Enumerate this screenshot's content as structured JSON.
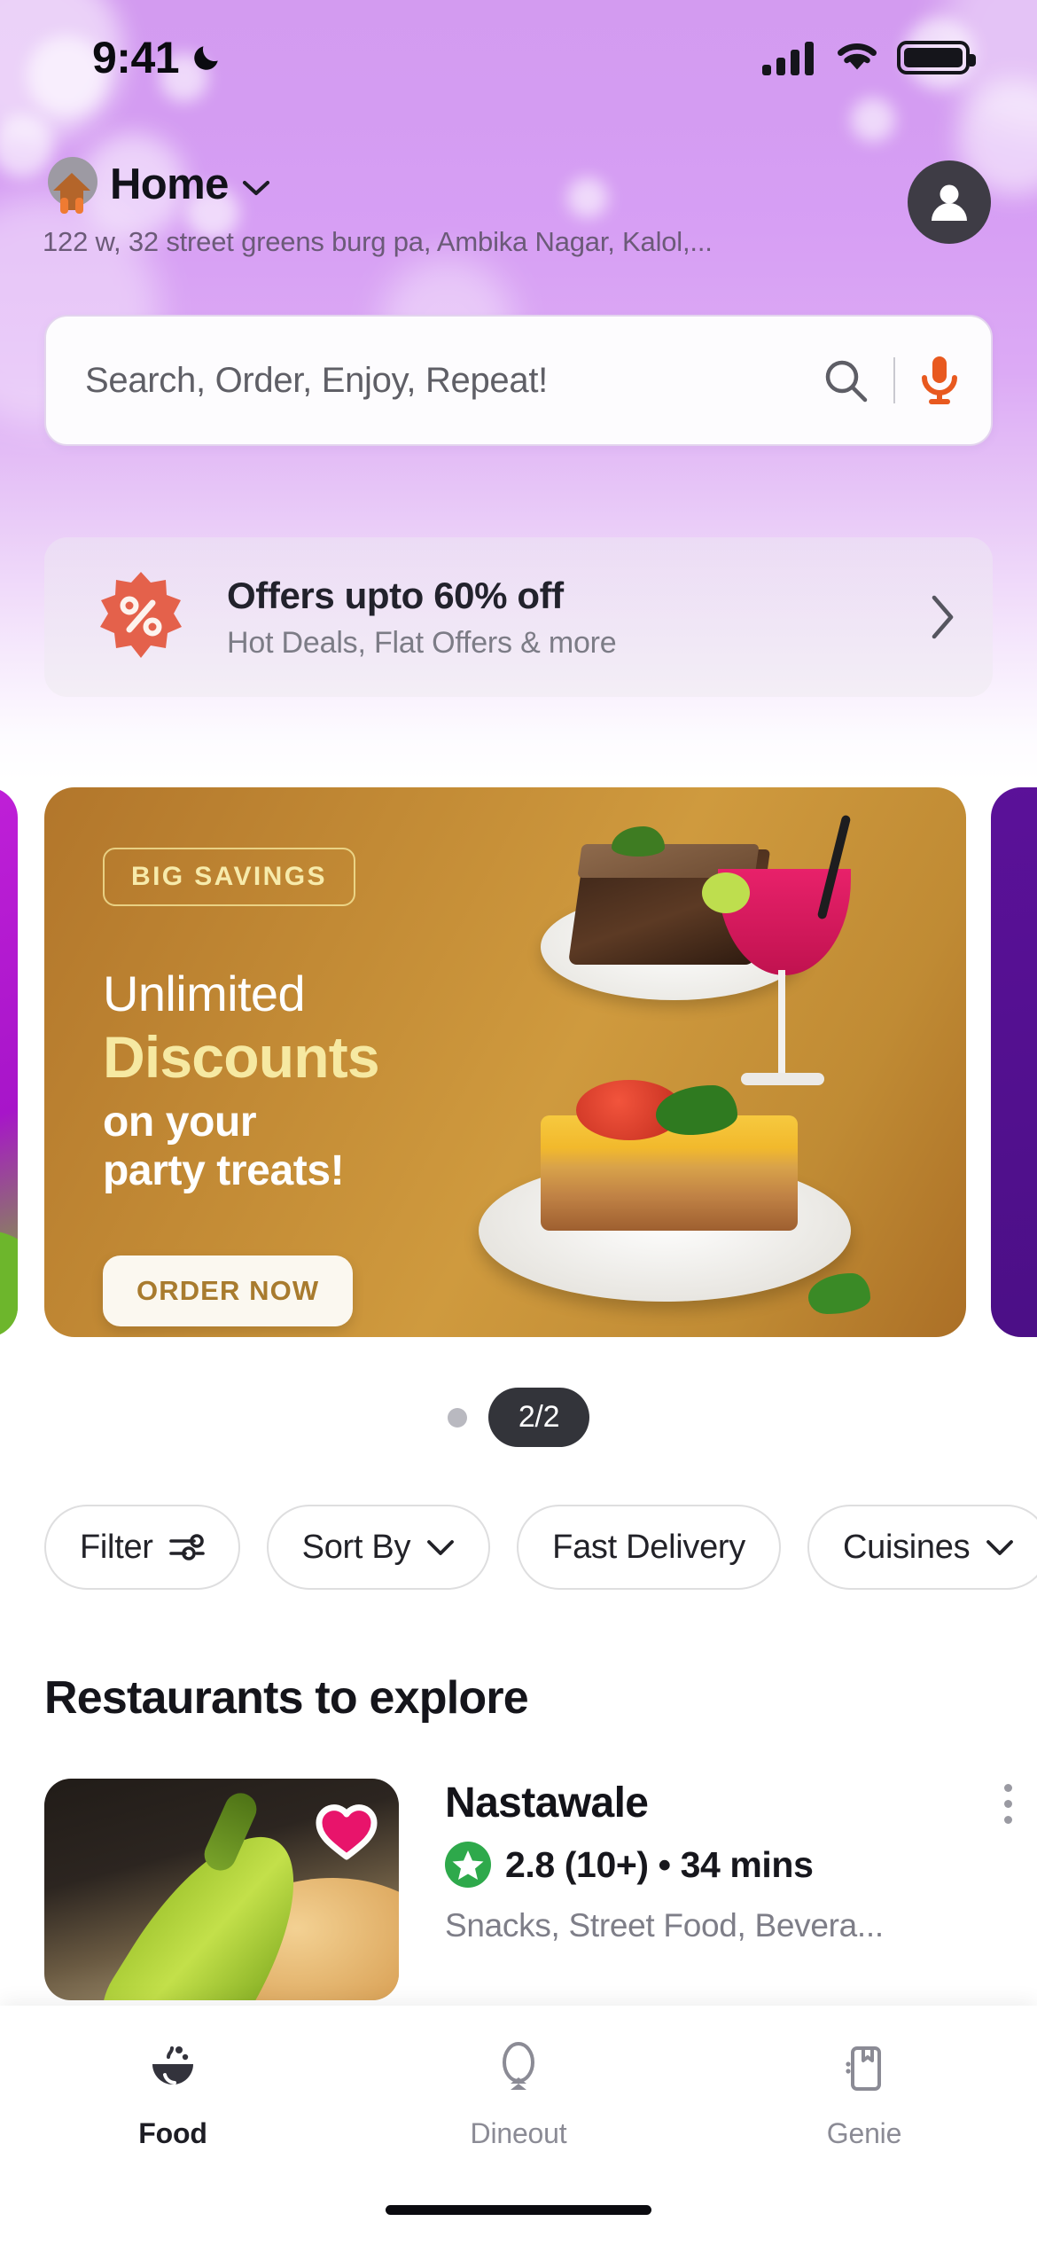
{
  "status_bar": {
    "time": "9:41",
    "moon_icon": "crescent-moon-icon",
    "signal_icon": "cellular-signal-icon",
    "wifi_icon": "wifi-icon",
    "battery_icon": "battery-full-icon"
  },
  "header": {
    "home_icon": "house-icon",
    "location_label": "Home",
    "chevron_icon": "chevron-down-icon",
    "address": "122 w, 32 street greens burg pa, Ambika Nagar, Kalol,...",
    "avatar_icon": "user-avatar-icon"
  },
  "search": {
    "placeholder": "Search, Order, Enjoy, Repeat!",
    "value": "",
    "search_icon": "search-icon",
    "mic_icon": "microphone-icon",
    "mic_color": "#E8591F"
  },
  "offers_banner": {
    "badge_icon": "percent-starburst-icon",
    "badge_color": "#E4614B",
    "title": "Offers upto 60% off",
    "subtitle": "Hot Deals, Flat Offers & more",
    "chevron_icon": "chevron-right-icon"
  },
  "carousel": {
    "current_slide": {
      "tag": "BIG SAVINGS",
      "line1": "Unlimited",
      "line2": "Discounts",
      "line3": "on your\nparty treats!",
      "cta_label": "ORDER NOW",
      "background_color": "#C08B34",
      "accent_color": "#F6E9A2"
    },
    "prev_slide_color": "#B41ECB",
    "next_slide_color": "#4F1090",
    "pager_label": "2/2",
    "pager_dot": "inactive-dot"
  },
  "filters": {
    "chips": [
      {
        "label": "Filter",
        "icon": "sliders-icon"
      },
      {
        "label": "Sort By",
        "icon": "chevron-down-icon"
      },
      {
        "label": "Fast Delivery",
        "icon": "none"
      },
      {
        "label": "Cuisines",
        "icon": "chevron-down-icon"
      }
    ]
  },
  "restaurants_section": {
    "title": "Restaurants to explore",
    "items": [
      {
        "name": "Nastawale",
        "rating": "2.8 (10+) • 34 mins",
        "cuisines": "Snacks, Street Food, Bevera...",
        "favorite_icon": "heart-filled-icon",
        "favorite_color": "#E8146B",
        "rating_badge_icon": "star-badge-icon",
        "rating_badge_color": "#2EA94B",
        "more_icon": "kebab-menu-icon"
      }
    ]
  },
  "bottom_nav": {
    "items": [
      {
        "label": "Food",
        "icon": "food-bowl-icon",
        "active": true
      },
      {
        "label": "Dineout",
        "icon": "plate-cutlery-icon",
        "active": false
      },
      {
        "label": "Genie",
        "icon": "shopping-bag-icon",
        "active": false
      }
    ]
  }
}
